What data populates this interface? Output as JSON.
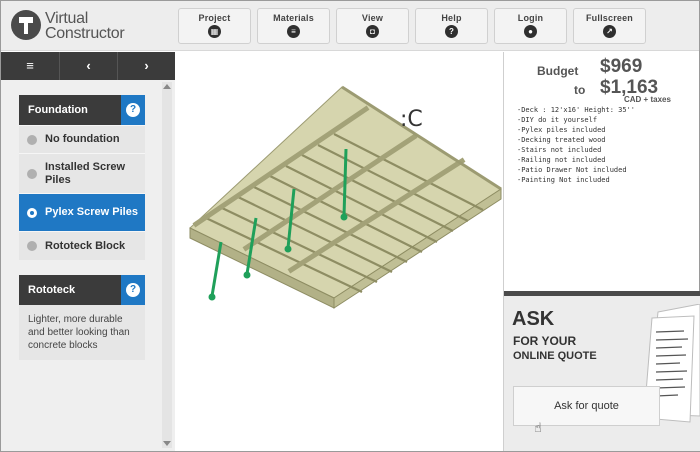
{
  "app": {
    "logo_line1": "Virtual",
    "logo_line2": "Constructor"
  },
  "nav": [
    {
      "label": "Project",
      "icon": "grid-icon"
    },
    {
      "label": "Materials",
      "icon": "list-icon"
    },
    {
      "label": "View",
      "icon": "camera-icon"
    },
    {
      "label": "Help",
      "icon": "question-icon"
    },
    {
      "label": "Login",
      "icon": "user-icon"
    },
    {
      "label": "Fullscreen",
      "icon": "share-icon"
    }
  ],
  "sidebar": {
    "toolbar": {
      "menu_glyph": "≡",
      "back_glyph": "‹",
      "forward_glyph": "›"
    },
    "foundation": {
      "title": "Foundation",
      "options": [
        {
          "label": "No foundation",
          "selected": false
        },
        {
          "label": "Installed Screw Piles",
          "selected": false
        },
        {
          "label": "Pylex Screw Piles",
          "selected": true
        },
        {
          "label": "Rototeck Block",
          "selected": false
        }
      ]
    },
    "rototeck": {
      "title": "Rototeck",
      "description": "Lighter, more durable and better looking than concrete blocks"
    }
  },
  "budget": {
    "label": "Budget",
    "min": "$969",
    "to_label": "to",
    "max": "$1,163",
    "currency_note": "CAD + taxes",
    "specs": [
      "-Deck : 12'x16'  Height: 35''",
      "-DIY do it yourself",
      "-Pylex piles included",
      "-Decking treated wood",
      "-Stairs not included",
      "-Railing not included",
      "-Patio Drawer Not included",
      "-Painting Not included"
    ]
  },
  "quote": {
    "title": "ASK",
    "subtitle1": "FOR YOUR",
    "subtitle2": "ONLINE QUOTE",
    "button_label": "Ask for quote"
  },
  "colors": {
    "accent": "#1f78c4",
    "dark": "#3b3b3b",
    "wood": "#c9c8a0",
    "pile": "#1fa05a"
  }
}
